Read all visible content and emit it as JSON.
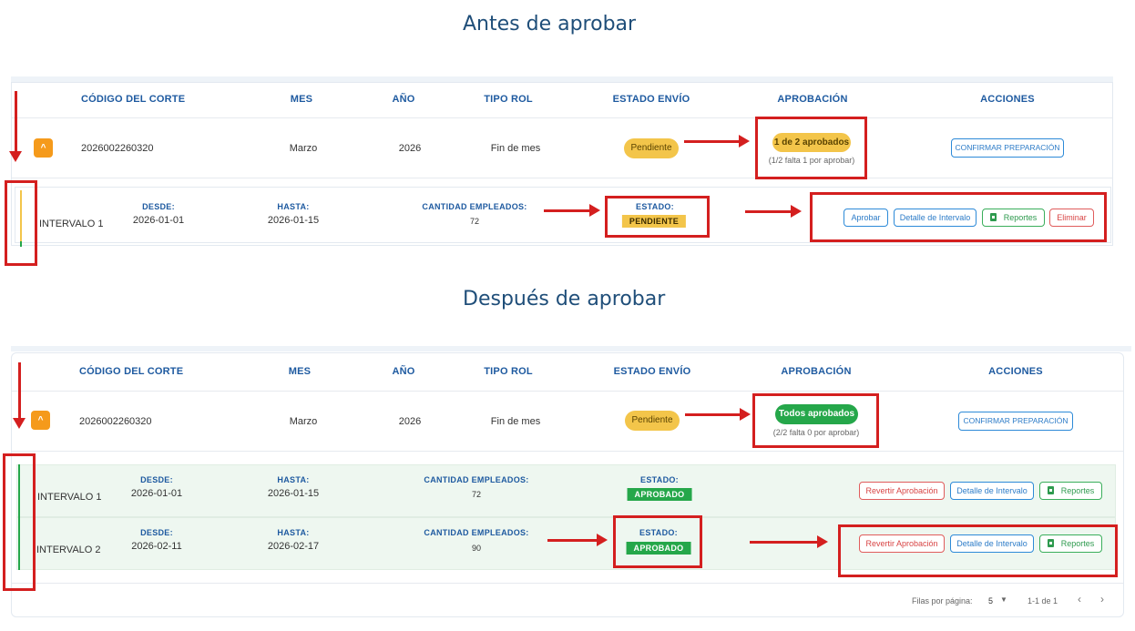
{
  "titles": {
    "before": "Antes de aprobar",
    "after": "Después de aprobar"
  },
  "headers": {
    "codigo": "CÓDIGO DEL CORTE",
    "mes": "MES",
    "anio": "AÑO",
    "tipo_rol": "TIPO ROL",
    "estado_envio": "ESTADO ENVÍO",
    "aprobacion": "APROBACIÓN",
    "acciones": "ACCIONES"
  },
  "before": {
    "row": {
      "codigo": "2026002260320",
      "mes": "Marzo",
      "anio": "2026",
      "tipo_rol": "Fin de mes",
      "estado_envio": "Pendiente",
      "aprobacion": "1 de 2 aprobados",
      "aprobacion_note": "(1/2 falta 1 por aprobar)",
      "accion": "CONFIRMAR PREPARACIÓN"
    },
    "interval": {
      "name": "INTERVALO 1",
      "desde_label": "DESDE:",
      "desde": "2026-01-01",
      "hasta_label": "HASTA:",
      "hasta": "2026-01-15",
      "cantidad_label": "CANTIDAD EMPLEADOS:",
      "cantidad": "72",
      "estado_label": "ESTADO:",
      "estado": "PENDIENTE",
      "buttons": {
        "aprobar": "Aprobar",
        "detalle": "Detalle de Intervalo",
        "reportes": "Reportes",
        "eliminar": "Eliminar"
      }
    }
  },
  "after": {
    "row": {
      "codigo": "2026002260320",
      "mes": "Marzo",
      "anio": "2026",
      "tipo_rol": "Fin de mes",
      "estado_envio": "Pendiente",
      "aprobacion": "Todos aprobados",
      "aprobacion_note": "(2/2 falta 0 por aprobar)",
      "accion": "CONFIRMAR PREPARACIÓN"
    },
    "intervals": [
      {
        "name": "INTERVALO 1",
        "desde_label": "DESDE:",
        "desde": "2026-01-01",
        "hasta_label": "HASTA:",
        "hasta": "2026-01-15",
        "cantidad_label": "CANTIDAD EMPLEADOS:",
        "cantidad": "72",
        "estado_label": "ESTADO:",
        "estado": "APROBADO",
        "buttons": {
          "revertir": "Revertir Aprobación",
          "detalle": "Detalle de Intervalo",
          "reportes": "Reportes"
        }
      },
      {
        "name": "INTERVALO 2",
        "desde_label": "DESDE:",
        "desde": "2026-02-11",
        "hasta_label": "HASTA:",
        "hasta": "2026-02-17",
        "cantidad_label": "CANTIDAD EMPLEADOS:",
        "cantidad": "90",
        "estado_label": "ESTADO:",
        "estado": "APROBADO",
        "buttons": {
          "revertir": "Revertir Aprobación",
          "detalle": "Detalle de Intervalo",
          "reportes": "Reportes"
        }
      }
    ],
    "footer": {
      "rows_label": "Filas por página:",
      "rows_value": "5",
      "range": "1-1 de 1"
    }
  },
  "icons": {
    "expand": "chevron-up-icon",
    "file": "spreadsheet-file-icon",
    "prev": "chevron-left-icon",
    "next": "chevron-right-icon",
    "dropdown": "caret-down-icon"
  },
  "colors": {
    "pending": "#f3c54a",
    "approved": "#25a74a",
    "accent": "#1e5aa0",
    "annotation": "#d41f1f",
    "expand": "#f59a1b"
  }
}
